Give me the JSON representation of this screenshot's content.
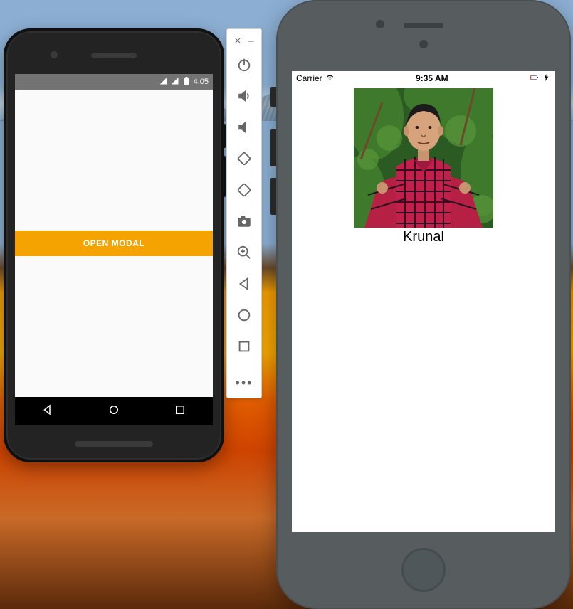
{
  "android": {
    "status_time": "4:05",
    "button_label": "OPEN MODAL"
  },
  "toolbar": {
    "close_glyph": "×",
    "minimize_glyph": "–",
    "more_glyph": "•••"
  },
  "iphone": {
    "carrier": "Carrier",
    "status_time": "9:35 AM",
    "caption": "Krunal"
  }
}
